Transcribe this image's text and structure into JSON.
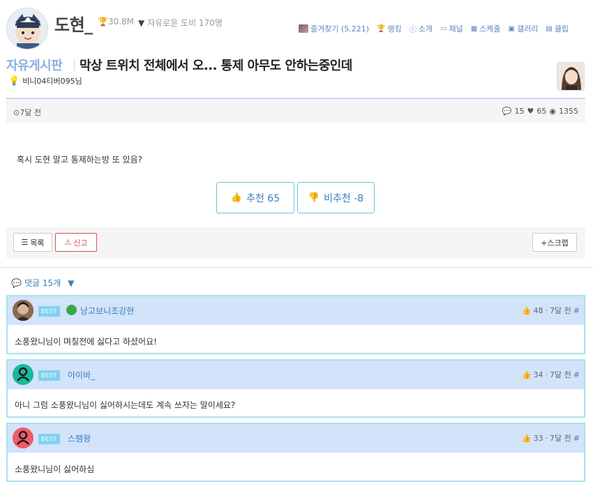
{
  "header": {
    "streamer_name": "도현_",
    "trophy_count": "30.8M",
    "followers": "자유로운 도비 170명",
    "nav": [
      {
        "icon": "favorite-thumb",
        "label": "즐겨찾기 (5,221)"
      },
      {
        "icon": "trophy-icon",
        "label": "랭킹"
      },
      {
        "icon": "info-icon",
        "label": "소개"
      },
      {
        "icon": "chat-icon",
        "label": "채널"
      },
      {
        "icon": "calendar-icon",
        "label": "스케줄"
      },
      {
        "icon": "image-icon",
        "label": "갤러리"
      },
      {
        "icon": "film-icon",
        "label": "클립"
      }
    ]
  },
  "post": {
    "board": "자유게시판",
    "title": "막상 트위치 전체에서 오... 통제 아무도 안하는중인데",
    "author": "비니04티버095님",
    "time": "7달 전",
    "comments_count": "15",
    "likes": "65",
    "views": "1355",
    "body": "혹시 도현 말고 통제하는방 또 있음?",
    "upvote_label": "추천 65",
    "downvote_label": "비추천 -8",
    "list_label": "목록",
    "report_label": "신고",
    "scrap_label": "+스크랩"
  },
  "comments_section": {
    "header": "댓글 15개",
    "items": [
      {
        "badge": "BEST",
        "user": "낭고보니조강현",
        "likes": "48",
        "time": "7달 전",
        "hash": "#",
        "text": "소풍왔니님이 며칠전에 싫다고 하셨어요!",
        "avatar_color": "#6b4a3a"
      },
      {
        "badge": "BEST",
        "user": "아이바_",
        "likes": "34",
        "time": "7달 전",
        "hash": "#",
        "text": "아니 그럼 소풍왔니님이 싫어하시는데도 계속 쓰자는 말이세요?",
        "avatar_color": "#18b89c"
      },
      {
        "badge": "BEST",
        "user": "스팸왕",
        "likes": "33",
        "time": "7달 전",
        "hash": "#",
        "text": "소풍왔니님이 싫어하심",
        "avatar_color": "#ef5b6b"
      }
    ]
  },
  "colors": {
    "accent": "#3a7fbf",
    "comment_header_bg": "#d2e3fa",
    "comment_border": "#a9e1ef",
    "best_badge": "#7ed3ee",
    "report": "#d9534f"
  }
}
